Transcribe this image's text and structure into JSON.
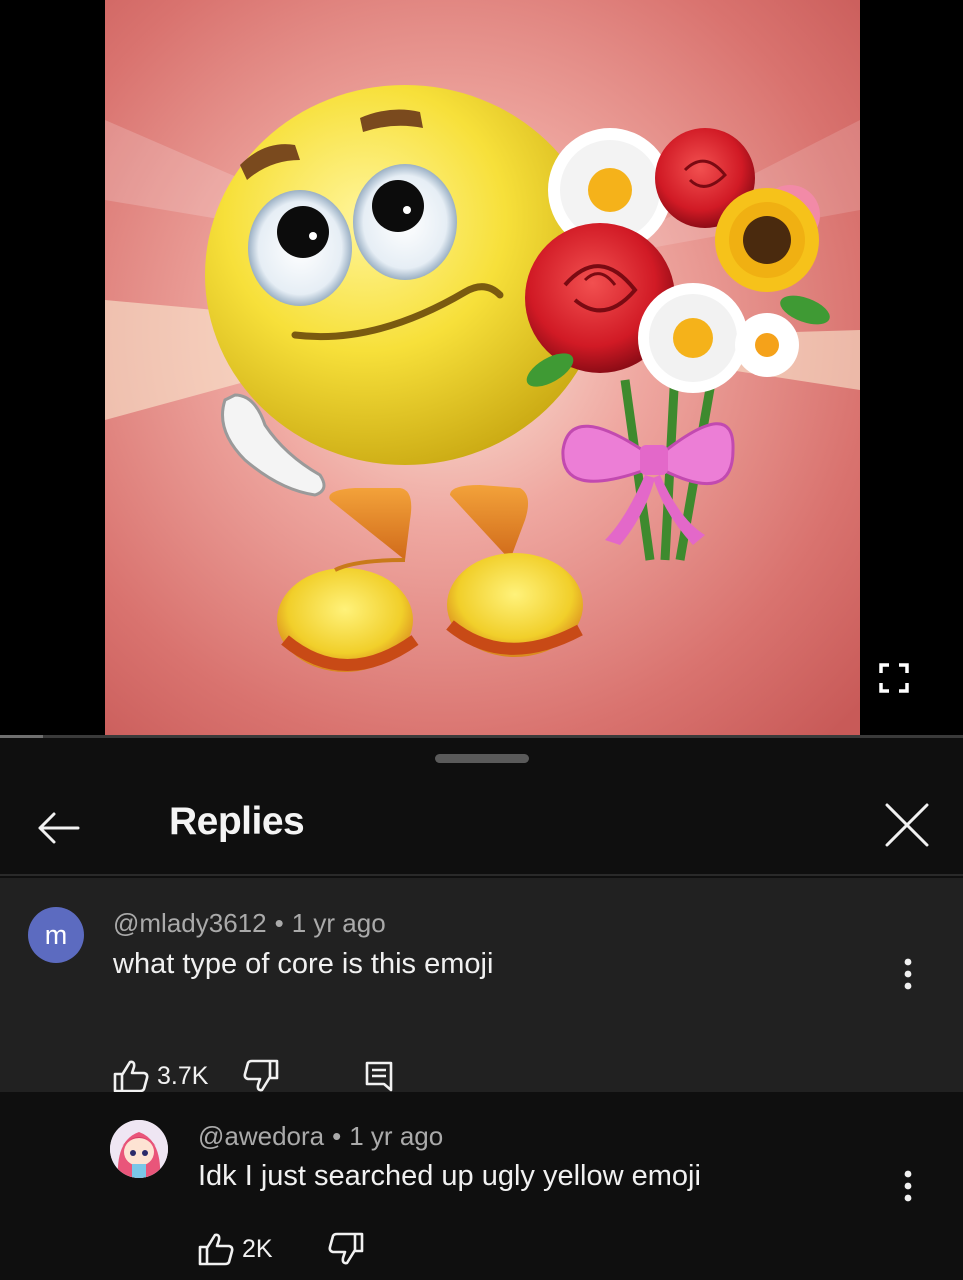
{
  "video": {
    "fullscreen_icon": "fullscreen-icon",
    "progress": 0.045
  },
  "sheet": {
    "title": "Replies",
    "back_icon": "arrow-left-icon",
    "close_icon": "close-icon"
  },
  "parent_comment": {
    "avatar_letter": "m",
    "avatar_color": "#5c6bc0",
    "author": "@mlady3612",
    "separator": "•",
    "time": "1 yr ago",
    "text": "what type of core is this emoji",
    "like_count": "3.7K"
  },
  "reply": {
    "author": "@awedora",
    "separator": "•",
    "time": "1 yr ago",
    "text": "Idk I just searched up ugly yellow emoji",
    "like_count": "2K"
  }
}
